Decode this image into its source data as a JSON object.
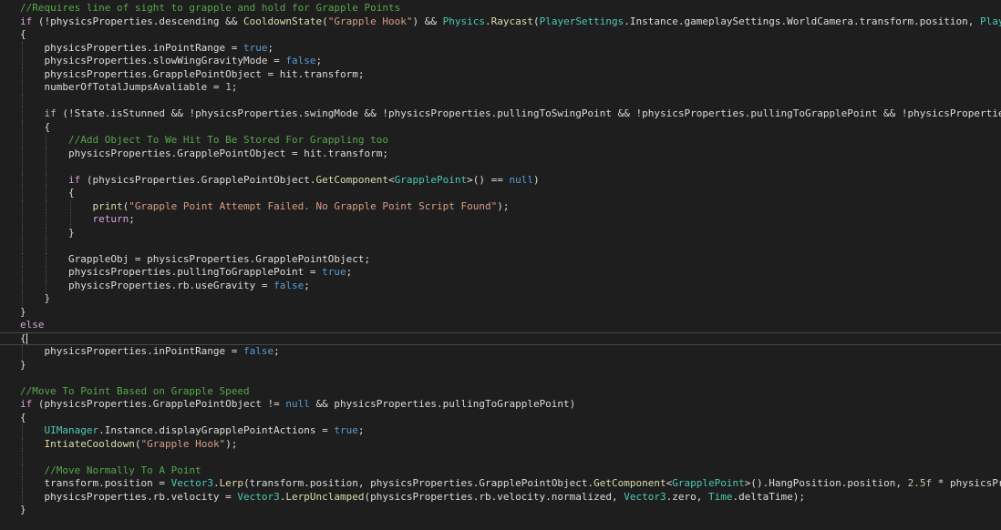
{
  "editor": {
    "language": "C#",
    "current_line_index": 25,
    "colors": {
      "background": "#1e1e1e",
      "plain": "#dcdcdc",
      "comment": "#57a64a",
      "keyword": "#569cd6",
      "control": "#d8a0df",
      "type": "#4ec9b0",
      "method": "#dcdcaa",
      "string": "#d69d85",
      "number": "#b5cea8"
    },
    "lines": [
      {
        "indent": 0,
        "tokens": [
          [
            "cmt",
            "//Requires line of sight to grapple and hold for Grapple Points"
          ]
        ]
      },
      {
        "indent": 0,
        "tokens": [
          [
            "ctl",
            "if"
          ],
          [
            "pl",
            " (!physicsProperties.descending && "
          ],
          [
            "fn",
            "CooldownState"
          ],
          [
            "pl",
            "("
          ],
          [
            "str",
            "\"Grapple Hook\""
          ],
          [
            "pl",
            ") && "
          ],
          [
            "typ",
            "Physics"
          ],
          [
            "pl",
            "."
          ],
          [
            "fn",
            "Raycast"
          ],
          [
            "pl",
            "("
          ],
          [
            "typ",
            "PlayerSettings"
          ],
          [
            "pl",
            ".Instance.gameplaySettings.WorldCamera.transform.position, "
          ],
          [
            "typ",
            "PlayerSettings"
          ]
        ]
      },
      {
        "indent": 0,
        "tokens": [
          [
            "pl",
            "{"
          ]
        ]
      },
      {
        "indent": 1,
        "tokens": [
          [
            "pl",
            "physicsProperties.inPointRange = "
          ],
          [
            "kw",
            "true"
          ],
          [
            "pl",
            ";"
          ]
        ]
      },
      {
        "indent": 1,
        "tokens": [
          [
            "pl",
            "physicsProperties.slowWingGravityMode = "
          ],
          [
            "kw",
            "false"
          ],
          [
            "pl",
            ";"
          ]
        ]
      },
      {
        "indent": 1,
        "tokens": [
          [
            "pl",
            "physicsProperties.GrapplePointObject = hit.transform;"
          ]
        ]
      },
      {
        "indent": 1,
        "tokens": [
          [
            "pl",
            "numberOfTotalJumpsAvaliable = "
          ],
          [
            "num",
            "1"
          ],
          [
            "pl",
            ";"
          ]
        ]
      },
      {
        "indent": 1,
        "tokens": []
      },
      {
        "indent": 1,
        "tokens": [
          [
            "ctl",
            "if"
          ],
          [
            "pl",
            " (!State.isStunned && !physicsProperties.swingMode && !physicsProperties.pullingToSwingPoint && !physicsProperties.pullingToGrapplePoint && !physicsProperties.h"
          ]
        ]
      },
      {
        "indent": 1,
        "tokens": [
          [
            "pl",
            "{"
          ]
        ]
      },
      {
        "indent": 2,
        "tokens": [
          [
            "cmt",
            "//Add Object To We Hit To Be Stored For Grappling too"
          ]
        ]
      },
      {
        "indent": 2,
        "tokens": [
          [
            "pl",
            "physicsProperties.GrapplePointObject = hit.transform;"
          ]
        ]
      },
      {
        "indent": 2,
        "tokens": []
      },
      {
        "indent": 2,
        "tokens": [
          [
            "ctl",
            "if"
          ],
          [
            "pl",
            " (physicsProperties.GrapplePointObject."
          ],
          [
            "fn",
            "GetComponent"
          ],
          [
            "pl",
            "<"
          ],
          [
            "typ",
            "GrapplePoint"
          ],
          [
            "pl",
            ">() == "
          ],
          [
            "kw",
            "null"
          ],
          [
            "pl",
            ")"
          ]
        ]
      },
      {
        "indent": 2,
        "tokens": [
          [
            "pl",
            "{"
          ]
        ]
      },
      {
        "indent": 3,
        "tokens": [
          [
            "fn",
            "print"
          ],
          [
            "pl",
            "("
          ],
          [
            "str",
            "\"Grapple Point Attempt Failed. No Grapple Point Script Found\""
          ],
          [
            "pl",
            ");"
          ]
        ]
      },
      {
        "indent": 3,
        "tokens": [
          [
            "ctl",
            "return"
          ],
          [
            "pl",
            ";"
          ]
        ]
      },
      {
        "indent": 2,
        "tokens": [
          [
            "pl",
            "}"
          ]
        ]
      },
      {
        "indent": 2,
        "tokens": []
      },
      {
        "indent": 2,
        "tokens": [
          [
            "pl",
            "GrappleObj = physicsProperties.GrapplePointObject;"
          ]
        ]
      },
      {
        "indent": 2,
        "tokens": [
          [
            "pl",
            "physicsProperties.pullingToGrapplePoint = "
          ],
          [
            "kw",
            "true"
          ],
          [
            "pl",
            ";"
          ]
        ]
      },
      {
        "indent": 2,
        "tokens": [
          [
            "pl",
            "physicsProperties.rb.useGravity = "
          ],
          [
            "kw",
            "false"
          ],
          [
            "pl",
            ";"
          ]
        ]
      },
      {
        "indent": 1,
        "tokens": [
          [
            "pl",
            "}"
          ]
        ]
      },
      {
        "indent": 0,
        "tokens": [
          [
            "pl",
            "}"
          ]
        ]
      },
      {
        "indent": 0,
        "tokens": [
          [
            "ctl",
            "else"
          ]
        ]
      },
      {
        "indent": 0,
        "tokens": [
          [
            "pl",
            "{"
          ]
        ]
      },
      {
        "indent": 1,
        "tokens": [
          [
            "pl",
            "physicsProperties.inPointRange = "
          ],
          [
            "kw",
            "false"
          ],
          [
            "pl",
            ";"
          ]
        ]
      },
      {
        "indent": 0,
        "tokens": [
          [
            "pl",
            "}"
          ]
        ]
      },
      {
        "indent": 0,
        "tokens": []
      },
      {
        "indent": 0,
        "tokens": [
          [
            "cmt",
            "//Move To Point Based on Grapple Speed"
          ]
        ]
      },
      {
        "indent": 0,
        "tokens": [
          [
            "ctl",
            "if"
          ],
          [
            "pl",
            " (physicsProperties.GrapplePointObject != "
          ],
          [
            "kw",
            "null"
          ],
          [
            "pl",
            " && physicsProperties.pullingToGrapplePoint)"
          ]
        ]
      },
      {
        "indent": 0,
        "tokens": [
          [
            "pl",
            "{"
          ]
        ]
      },
      {
        "indent": 1,
        "tokens": [
          [
            "typ",
            "UIManager"
          ],
          [
            "pl",
            ".Instance.displayGrapplePointActions = "
          ],
          [
            "kw",
            "true"
          ],
          [
            "pl",
            ";"
          ]
        ]
      },
      {
        "indent": 1,
        "tokens": [
          [
            "fn",
            "IntiateCooldown"
          ],
          [
            "pl",
            "("
          ],
          [
            "str",
            "\"Grapple Hook\""
          ],
          [
            "pl",
            ");"
          ]
        ]
      },
      {
        "indent": 1,
        "tokens": []
      },
      {
        "indent": 1,
        "tokens": [
          [
            "cmt",
            "//Move Normally To A Point"
          ]
        ]
      },
      {
        "indent": 1,
        "tokens": [
          [
            "pl",
            "transform.position = "
          ],
          [
            "typ",
            "Vector3"
          ],
          [
            "pl",
            "."
          ],
          [
            "fn",
            "Lerp"
          ],
          [
            "pl",
            "(transform.position, physicsProperties.GrapplePointObject."
          ],
          [
            "fn",
            "GetComponent"
          ],
          [
            "pl",
            "<"
          ],
          [
            "typ",
            "GrapplePoint"
          ],
          [
            "pl",
            ">().HangPosition.position, "
          ],
          [
            "num",
            "2.5f"
          ],
          [
            "pl",
            " * physicsPrope"
          ]
        ]
      },
      {
        "indent": 1,
        "tokens": [
          [
            "pl",
            "physicsProperties.rb.velocity = "
          ],
          [
            "typ",
            "Vector3"
          ],
          [
            "pl",
            "."
          ],
          [
            "fn",
            "LerpUnclamped"
          ],
          [
            "pl",
            "(physicsProperties.rb.velocity.normalized, "
          ],
          [
            "typ",
            "Vector3"
          ],
          [
            "pl",
            ".zero, "
          ],
          [
            "typ",
            "Time"
          ],
          [
            "pl",
            ".deltaTime);"
          ]
        ]
      },
      {
        "indent": 0,
        "tokens": [
          [
            "pl",
            "}"
          ]
        ]
      }
    ]
  }
}
